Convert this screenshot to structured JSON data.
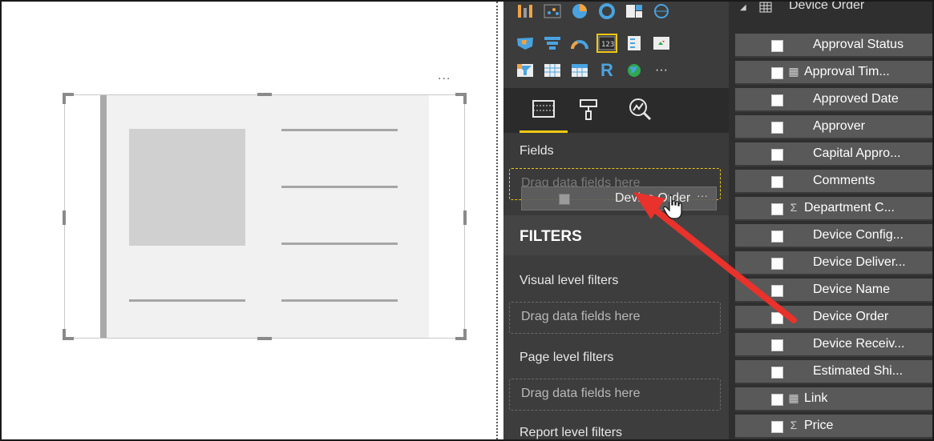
{
  "canvas": {
    "more_options": "...",
    "visual_placeholder": "card-visual"
  },
  "visualizations": {
    "icons": [
      [
        "ribbon-chart-icon",
        "scatter-chart-icon",
        "pie-chart-icon",
        "donut-chart-icon",
        "treemap-icon",
        "map-icon"
      ],
      [
        "filled-map-icon",
        "funnel-icon",
        "gauge-icon",
        "card-icon",
        "multi-row-card-icon",
        "kpi-icon"
      ],
      [
        "slicer-icon",
        "table-icon",
        "matrix-icon",
        "r-visual-icon",
        "globe-icon",
        "more-visuals-icon"
      ]
    ],
    "r_letter": "R",
    "more": "···",
    "tabs": [
      "fields-tab-icon",
      "format-tab-icon",
      "analytics-tab-icon"
    ],
    "fields_title": "Fields",
    "fields_drop_placeholder": "Drag data fields here",
    "drag_ghost_label": "Device Order",
    "drag_ghost_more": "···",
    "filters_title": "FILTERS",
    "visual_level_filters": "Visual level filters",
    "visual_drop_placeholder": "Drag data fields here",
    "page_level_filters": "Page level filters",
    "page_drop_placeholder": "Drag data fields here",
    "report_level_filters": "Report level filters"
  },
  "field_list": {
    "table_name": "Device Order",
    "fields": [
      {
        "name": "Approval Status",
        "type": ""
      },
      {
        "name": "Approval Tim...",
        "type": "calendar"
      },
      {
        "name": "Approved Date",
        "type": ""
      },
      {
        "name": "Approver",
        "type": ""
      },
      {
        "name": "Capital Appro...",
        "type": ""
      },
      {
        "name": "Comments",
        "type": ""
      },
      {
        "name": "Department C...",
        "type": "sum"
      },
      {
        "name": "Device Config...",
        "type": ""
      },
      {
        "name": "Device Deliver...",
        "type": ""
      },
      {
        "name": "Device Name",
        "type": ""
      },
      {
        "name": "Device Order",
        "type": ""
      },
      {
        "name": "Device Receiv...",
        "type": ""
      },
      {
        "name": "Estimated Shi...",
        "type": ""
      },
      {
        "name": "Link",
        "type": "calendar"
      },
      {
        "name": "Price",
        "type": "sum"
      }
    ],
    "type_glyphs": {
      "calendar": "▦",
      "sum": "Σ"
    }
  },
  "colors": {
    "accent": "#f2c811",
    "arrow": "#e8322b"
  }
}
